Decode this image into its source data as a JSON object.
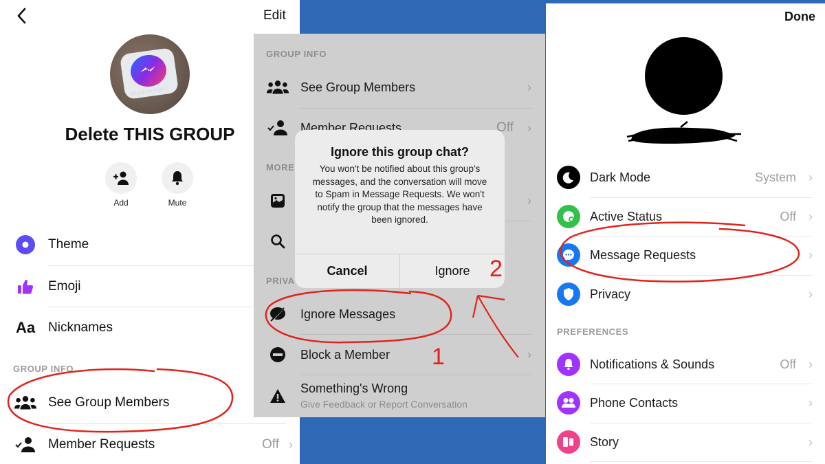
{
  "left_panel": {
    "back_label": "Back",
    "edit_label": "Edit",
    "avatar_text": "Messenger",
    "group_name": "Delete THIS GROUP",
    "quick_actions": [
      {
        "label": "Add",
        "icon": "add-person-icon"
      },
      {
        "label": "Mute",
        "icon": "bell-icon"
      }
    ],
    "customize_items": [
      {
        "label": "Theme",
        "icon": "theme-icon",
        "color": "#5b4cf5"
      },
      {
        "label": "Emoji",
        "icon": "thumbs-up-icon",
        "color": "#a033ff"
      },
      {
        "label": "Nicknames",
        "icon": "aa-text-icon",
        "glyph": "Aa"
      }
    ],
    "group_info_header": "GROUP INFO",
    "group_info_items": [
      {
        "label": "See Group Members",
        "icon": "group-members-icon"
      },
      {
        "label": "Member Requests",
        "icon": "member-requests-icon",
        "value": "Off"
      }
    ]
  },
  "middle_panel": {
    "group_info_header": "GROUP INFO",
    "group_info_items": [
      {
        "label": "See Group Members",
        "icon": "group-members-icon"
      },
      {
        "label": "Member Requests",
        "icon": "member-requests-icon",
        "value": "Off"
      }
    ],
    "more_header": "MORE",
    "more_items": [
      {
        "label": "",
        "icon": "photo-icon"
      },
      {
        "label": "",
        "icon": "search-icon"
      }
    ],
    "privacy_header": "PRIVA",
    "privacy_items": [
      {
        "label": "Ignore Messages",
        "icon": "ignore-messages-icon"
      },
      {
        "label": "Block a Member",
        "icon": "block-icon"
      },
      {
        "label": "Something's Wrong",
        "sublabel": "Give Feedback or Report Conversation",
        "icon": "warning-icon"
      }
    ],
    "dialog": {
      "title": "Ignore this group chat?",
      "body": "You won't be notified about this group's messages, and the conversation will move to Spam in Message Requests. We won't notify the group that the messages have been ignored.",
      "cancel_label": "Cancel",
      "confirm_label": "Ignore"
    }
  },
  "right_panel": {
    "done_label": "Done",
    "settings_items": [
      {
        "label": "Dark Mode",
        "value": "System",
        "icon": "moon-icon",
        "color": "#000000"
      },
      {
        "label": "Active Status",
        "value": "Off",
        "icon": "active-status-icon",
        "color": "#31c04a"
      },
      {
        "label": "Message Requests",
        "icon": "message-requests-icon",
        "color": "#1877f2"
      },
      {
        "label": "Privacy",
        "icon": "shield-icon",
        "color": "#1877f2"
      }
    ],
    "preferences_header": "PREFERENCES",
    "preferences_items": [
      {
        "label": "Notifications & Sounds",
        "value": "Off",
        "icon": "bell-icon",
        "color": "#a033ff"
      },
      {
        "label": "Phone Contacts",
        "icon": "contacts-icon",
        "color": "#a033ff"
      },
      {
        "label": "Story",
        "icon": "story-icon",
        "color": "#f0418b"
      }
    ]
  },
  "annotations": {
    "step_1": "1",
    "step_2": "2",
    "ink_color": "#e0241b"
  },
  "colors": {
    "backdrop_blue": "#2f68b5",
    "dimmed_panel": "#cfcfcf",
    "chevron": "›"
  }
}
